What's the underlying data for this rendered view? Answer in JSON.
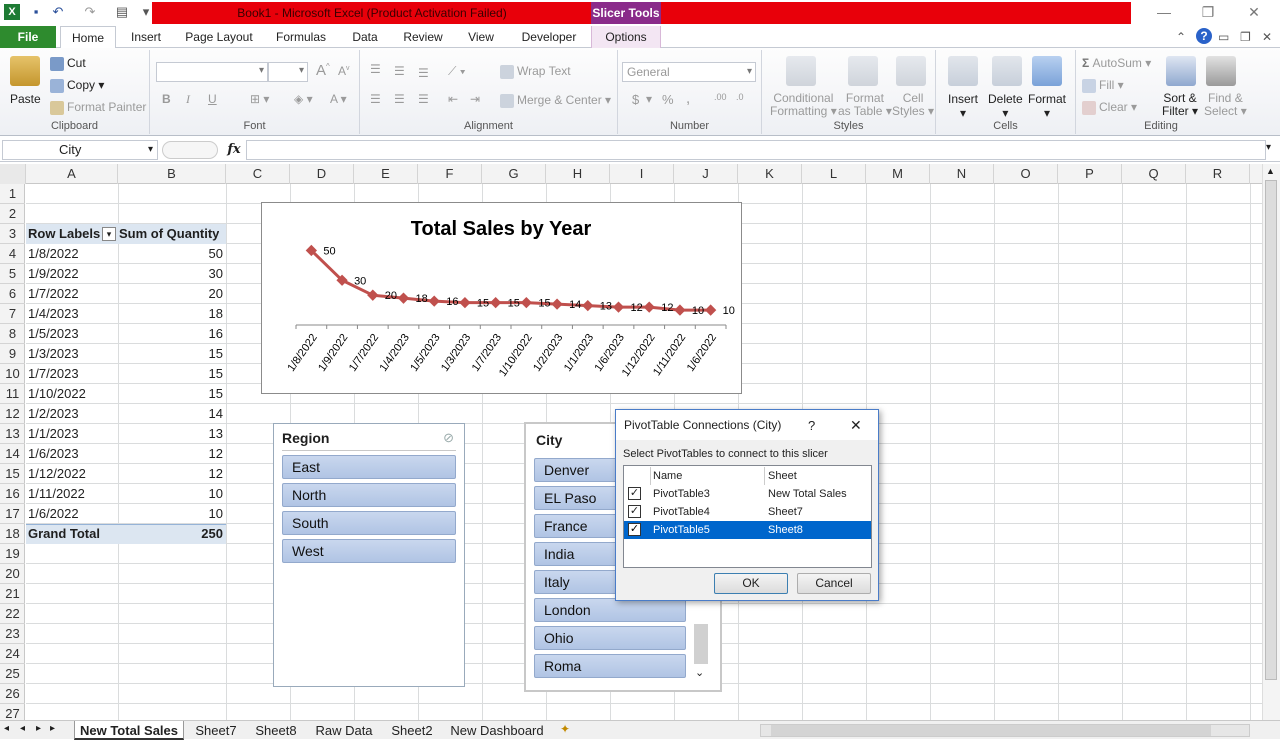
{
  "window": {
    "title": "Book1 - Microsoft Excel (Product Activation Failed)",
    "context_tab": "Slicer Tools"
  },
  "ribbon_tabs": [
    "File",
    "Home",
    "Insert",
    "Page Layout",
    "Formulas",
    "Data",
    "Review",
    "View",
    "Developer",
    "Options"
  ],
  "ribbon": {
    "clipboard": {
      "paste": "Paste",
      "cut": "Cut",
      "copy": "Copy",
      "format_painter": "Format Painter",
      "label": "Clipboard"
    },
    "font": {
      "label": "Font",
      "bold": "B",
      "italic": "I",
      "underline": "U"
    },
    "alignment": {
      "wrap_text": "Wrap Text",
      "merge_center": "Merge & Center",
      "label": "Alignment"
    },
    "number": {
      "format": "General",
      "currency": "$",
      "percent": "%",
      "comma": ",",
      "label": "Number"
    },
    "styles": {
      "conditional": "Conditional",
      "conditional2": "Formatting",
      "format_as": "Format",
      "format_as2": "as Table",
      "cell_styles": "Cell",
      "cell_styles2": "Styles",
      "label": "Styles"
    },
    "cells": {
      "insert": "Insert",
      "delete": "Delete",
      "format": "Format",
      "label": "Cells"
    },
    "editing": {
      "autosum": "AutoSum",
      "fill": "Fill",
      "clear": "Clear",
      "sort": "Sort &",
      "sort2": "Filter",
      "find": "Find &",
      "find2": "Select",
      "label": "Editing"
    }
  },
  "formula_bar": {
    "name_box": "City",
    "fx": "fx",
    "formula": ""
  },
  "columns": [
    "A",
    "B",
    "C",
    "D",
    "E",
    "F",
    "G",
    "H",
    "I",
    "J",
    "K",
    "L",
    "M",
    "N",
    "O",
    "P",
    "Q",
    "R"
  ],
  "rows": [
    "1",
    "2",
    "3",
    "4",
    "5",
    "6",
    "7",
    "8",
    "9",
    "10",
    "11",
    "12",
    "13",
    "14",
    "15",
    "16",
    "17",
    "18",
    "19",
    "20",
    "21",
    "22",
    "23",
    "24",
    "25",
    "26",
    "27"
  ],
  "pivot": {
    "header_labels": "Row Labels",
    "header_sum": "Sum of Quantity",
    "rows": [
      {
        "label": "1/8/2022",
        "value": "50"
      },
      {
        "label": "1/9/2022",
        "value": "30"
      },
      {
        "label": "1/7/2022",
        "value": "20"
      },
      {
        "label": "1/4/2023",
        "value": "18"
      },
      {
        "label": "1/5/2023",
        "value": "16"
      },
      {
        "label": "1/3/2023",
        "value": "15"
      },
      {
        "label": "1/7/2023",
        "value": "15"
      },
      {
        "label": "1/10/2022",
        "value": "15"
      },
      {
        "label": "1/2/2023",
        "value": "14"
      },
      {
        "label": "1/1/2023",
        "value": "13"
      },
      {
        "label": "1/6/2023",
        "value": "12"
      },
      {
        "label": "1/12/2022",
        "value": "12"
      },
      {
        "label": "1/11/2022",
        "value": "10"
      },
      {
        "label": "1/6/2022",
        "value": "10"
      }
    ],
    "grand_total_label": "Grand Total",
    "grand_total_value": "250"
  },
  "chart_data": {
    "type": "line",
    "title": "Total Sales by Year",
    "categories": [
      "1/8/2022",
      "1/9/2022",
      "1/7/2022",
      "1/4/2023",
      "1/5/2023",
      "1/3/2023",
      "1/7/2023",
      "1/10/2022",
      "1/2/2023",
      "1/1/2023",
      "1/6/2023",
      "1/12/2022",
      "1/11/2022",
      "1/6/2022"
    ],
    "series": [
      {
        "values": [
          50,
          30,
          20,
          18,
          16,
          15,
          15,
          15,
          14,
          13,
          12,
          12,
          10,
          10
        ]
      }
    ],
    "ylim": [
      0,
      55
    ],
    "grid": false,
    "color": "#c0504d"
  },
  "slicer_region": {
    "title": "Region",
    "items": [
      "East",
      "North",
      "South",
      "West"
    ]
  },
  "slicer_city": {
    "title": "City",
    "items": [
      "Denver",
      "EL Paso",
      "France",
      "India",
      "Italy",
      "London",
      "Ohio",
      "Roma"
    ]
  },
  "dialog": {
    "title": "PivotTable Connections (City)",
    "help": "?",
    "close": "✕",
    "prompt": "Select PivotTables to connect to this slicer",
    "col_name": "Name",
    "col_sheet": "Sheet",
    "rows": [
      {
        "name": "PivotTable3",
        "sheet": "New Total Sales",
        "checked": "✓"
      },
      {
        "name": "PivotTable4",
        "sheet": "Sheet7",
        "checked": "✓"
      },
      {
        "name": "PivotTable5",
        "sheet": "Sheet8",
        "checked": "✓"
      }
    ],
    "ok": "OK",
    "cancel": "Cancel"
  },
  "sheet_tabs": [
    "New Total Sales",
    "Sheet7",
    "Sheet8",
    "Raw Data",
    "Sheet2",
    "New Dashboard"
  ]
}
